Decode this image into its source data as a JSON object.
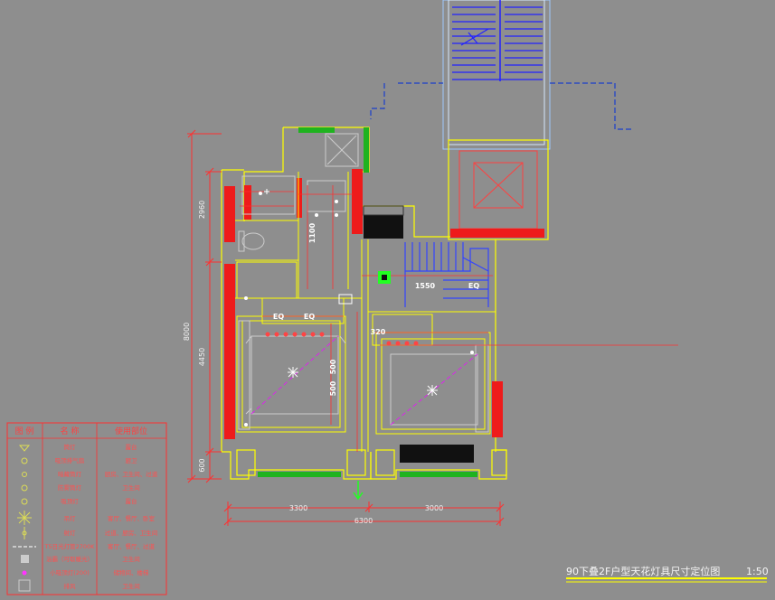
{
  "drawing": {
    "title": "90下叠2F户型天花灯具尺寸定位图",
    "scale": "1:50",
    "dimensions": {
      "top_vertical": "2960",
      "mid_vertical": "4450",
      "total_vertical": "8000",
      "bottom_vertical": "600",
      "left_horizontal": "3300",
      "right_horizontal": "3000",
      "total_horizontal": "6300"
    },
    "room_labels": {
      "stair_width": "1550",
      "eq_left_a": "EQ",
      "eq_left_b": "EQ",
      "eq_right": "EQ",
      "dim_320": "320",
      "dim_500_a": "500",
      "dim_500_b": "500",
      "dim_1100": "1100"
    }
  },
  "legend": {
    "headers": [
      "图 例",
      "名 称",
      "使用部位"
    ],
    "rows": [
      {
        "name": "筒灯",
        "usage": "露台"
      },
      {
        "name": "吸顶排气扇",
        "usage": "厨卫"
      },
      {
        "name": "暗藏筒灯",
        "usage": "厨房、卫生间、过道"
      },
      {
        "name": "防雾筒灯",
        "usage": "卫生间"
      },
      {
        "name": "吸顶灯",
        "usage": "露台"
      },
      {
        "name": "吊灯",
        "usage": "客厅、餐厅、卧室"
      },
      {
        "name": "射灯",
        "usage": "过道、厨房、卫生间"
      },
      {
        "name": "T5日光灯管2700K",
        "usage": "客厅、餐厅、过道"
      },
      {
        "name": "浴霸（可取暖光）",
        "usage": "卫生间"
      },
      {
        "name": "小吸顶灯(200)",
        "usage": "储物间、楼梯"
      },
      {
        "name": "排风",
        "usage": "卫生间"
      }
    ]
  }
}
